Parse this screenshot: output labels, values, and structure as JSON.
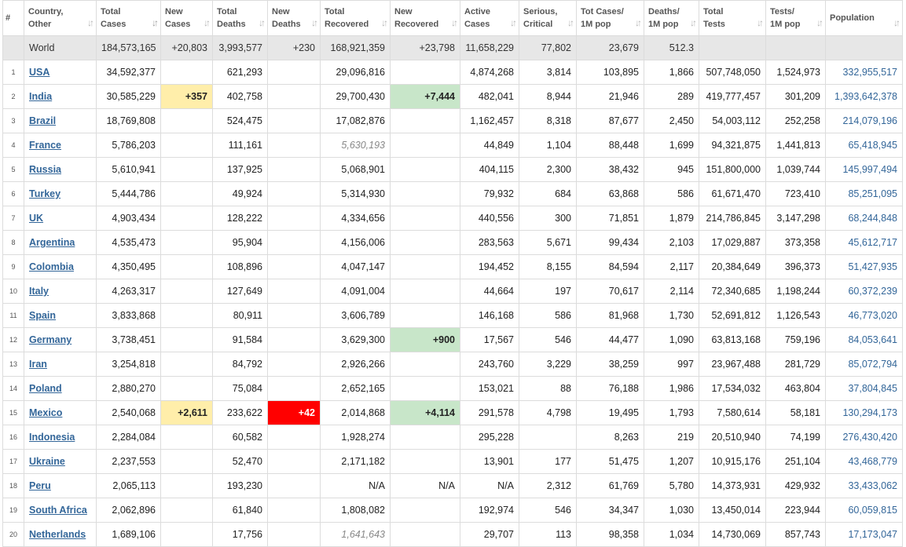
{
  "colors": {
    "new_cases_bg": "#ffeeaa",
    "new_recovered_bg": "#c8e6c9",
    "new_deaths_bg": "#ff0000",
    "link": "#336699",
    "world_row_bg": "#e7e7e7"
  },
  "columns": [
    {
      "line1": "#",
      "line2": "",
      "sort_icon": "none"
    },
    {
      "line1": "Country,",
      "line2": "Other",
      "sort_icon": "sort-arrows-icon"
    },
    {
      "line1": "Total",
      "line2": "Cases",
      "sort_icon": "sort-descending-icon"
    },
    {
      "line1": "New",
      "line2": "Cases",
      "sort_icon": "sort-arrows-icon"
    },
    {
      "line1": "Total",
      "line2": "Deaths",
      "sort_icon": "sort-arrows-icon"
    },
    {
      "line1": "New",
      "line2": "Deaths",
      "sort_icon": "sort-arrows-icon"
    },
    {
      "line1": "Total",
      "line2": "Recovered",
      "sort_icon": "sort-arrows-icon"
    },
    {
      "line1": "New",
      "line2": "Recovered",
      "sort_icon": "sort-arrows-icon"
    },
    {
      "line1": "Active",
      "line2": "Cases",
      "sort_icon": "sort-arrows-icon"
    },
    {
      "line1": "Serious,",
      "line2": "Critical",
      "sort_icon": "sort-arrows-icon"
    },
    {
      "line1": "Tot Cases/",
      "line2": "1M pop",
      "sort_icon": "sort-arrows-icon"
    },
    {
      "line1": "Deaths/",
      "line2": "1M pop",
      "sort_icon": "sort-arrows-icon"
    },
    {
      "line1": "Total",
      "line2": "Tests",
      "sort_icon": "sort-arrows-icon"
    },
    {
      "line1": "Tests/",
      "line2": "1M pop",
      "sort_icon": "sort-arrows-icon"
    },
    {
      "line1": "Population",
      "line2": "",
      "sort_icon": "sort-arrows-icon"
    }
  ],
  "world": [
    "",
    "World",
    "184,573,165",
    "+20,803",
    "3,993,577",
    "+230",
    "168,921,359",
    "+23,798",
    "11,658,229",
    "77,802",
    "23,679",
    "512.3",
    "",
    "",
    ""
  ],
  "rows": [
    [
      "1",
      "USA",
      "34,592,377",
      "",
      "621,293",
      "",
      "29,096,816",
      "",
      "4,874,268",
      "3,814",
      "103,895",
      "1,866",
      "507,748,050",
      "1,524,973",
      "332,955,517"
    ],
    [
      "2",
      "India",
      "30,585,229",
      "+357",
      "402,758",
      "",
      "29,700,430",
      "+7,444",
      "482,041",
      "8,944",
      "21,946",
      "289",
      "419,777,457",
      "301,209",
      "1,393,642,378"
    ],
    [
      "3",
      "Brazil",
      "18,769,808",
      "",
      "524,475",
      "",
      "17,082,876",
      "",
      "1,162,457",
      "8,318",
      "87,677",
      "2,450",
      "54,003,112",
      "252,258",
      "214,079,196"
    ],
    [
      "4",
      "France",
      "5,786,203",
      "",
      "111,161",
      "",
      "5,630,193",
      "",
      "44,849",
      "1,104",
      "88,448",
      "1,699",
      "94,321,875",
      "1,441,813",
      "65,418,945"
    ],
    [
      "5",
      "Russia",
      "5,610,941",
      "",
      "137,925",
      "",
      "5,068,901",
      "",
      "404,115",
      "2,300",
      "38,432",
      "945",
      "151,800,000",
      "1,039,744",
      "145,997,494"
    ],
    [
      "6",
      "Turkey",
      "5,444,786",
      "",
      "49,924",
      "",
      "5,314,930",
      "",
      "79,932",
      "684",
      "63,868",
      "586",
      "61,671,470",
      "723,410",
      "85,251,095"
    ],
    [
      "7",
      "UK",
      "4,903,434",
      "",
      "128,222",
      "",
      "4,334,656",
      "",
      "440,556",
      "300",
      "71,851",
      "1,879",
      "214,786,845",
      "3,147,298",
      "68,244,848"
    ],
    [
      "8",
      "Argentina",
      "4,535,473",
      "",
      "95,904",
      "",
      "4,156,006",
      "",
      "283,563",
      "5,671",
      "99,434",
      "2,103",
      "17,029,887",
      "373,358",
      "45,612,717"
    ],
    [
      "9",
      "Colombia",
      "4,350,495",
      "",
      "108,896",
      "",
      "4,047,147",
      "",
      "194,452",
      "8,155",
      "84,594",
      "2,117",
      "20,384,649",
      "396,373",
      "51,427,935"
    ],
    [
      "10",
      "Italy",
      "4,263,317",
      "",
      "127,649",
      "",
      "4,091,004",
      "",
      "44,664",
      "197",
      "70,617",
      "2,114",
      "72,340,685",
      "1,198,244",
      "60,372,239"
    ],
    [
      "11",
      "Spain",
      "3,833,868",
      "",
      "80,911",
      "",
      "3,606,789",
      "",
      "146,168",
      "586",
      "81,968",
      "1,730",
      "52,691,812",
      "1,126,543",
      "46,773,020"
    ],
    [
      "12",
      "Germany",
      "3,738,451",
      "",
      "91,584",
      "",
      "3,629,300",
      "+900",
      "17,567",
      "546",
      "44,477",
      "1,090",
      "63,813,168",
      "759,196",
      "84,053,641"
    ],
    [
      "13",
      "Iran",
      "3,254,818",
      "",
      "84,792",
      "",
      "2,926,266",
      "",
      "243,760",
      "3,229",
      "38,259",
      "997",
      "23,967,488",
      "281,729",
      "85,072,794"
    ],
    [
      "14",
      "Poland",
      "2,880,270",
      "",
      "75,084",
      "",
      "2,652,165",
      "",
      "153,021",
      "88",
      "76,188",
      "1,986",
      "17,534,032",
      "463,804",
      "37,804,845"
    ],
    [
      "15",
      "Mexico",
      "2,540,068",
      "+2,611",
      "233,622",
      "+42",
      "2,014,868",
      "+4,114",
      "291,578",
      "4,798",
      "19,495",
      "1,793",
      "7,580,614",
      "58,181",
      "130,294,173"
    ],
    [
      "16",
      "Indonesia",
      "2,284,084",
      "",
      "60,582",
      "",
      "1,928,274",
      "",
      "295,228",
      "",
      "8,263",
      "219",
      "20,510,940",
      "74,199",
      "276,430,420"
    ],
    [
      "17",
      "Ukraine",
      "2,237,553",
      "",
      "52,470",
      "",
      "2,171,182",
      "",
      "13,901",
      "177",
      "51,475",
      "1,207",
      "10,915,176",
      "251,104",
      "43,468,779"
    ],
    [
      "18",
      "Peru",
      "2,065,113",
      "",
      "193,230",
      "",
      "N/A",
      "N/A",
      "N/A",
      "2,312",
      "61,769",
      "5,780",
      "14,373,931",
      "429,932",
      "33,433,062"
    ],
    [
      "19",
      "South Africa",
      "2,062,896",
      "",
      "61,840",
      "",
      "1,808,082",
      "",
      "192,974",
      "546",
      "34,347",
      "1,030",
      "13,450,014",
      "223,944",
      "60,059,815"
    ],
    [
      "20",
      "Netherlands",
      "1,689,106",
      "",
      "17,756",
      "",
      "1,641,643",
      "",
      "29,707",
      "113",
      "98,358",
      "1,034",
      "14,730,069",
      "857,743",
      "17,173,047"
    ]
  ]
}
